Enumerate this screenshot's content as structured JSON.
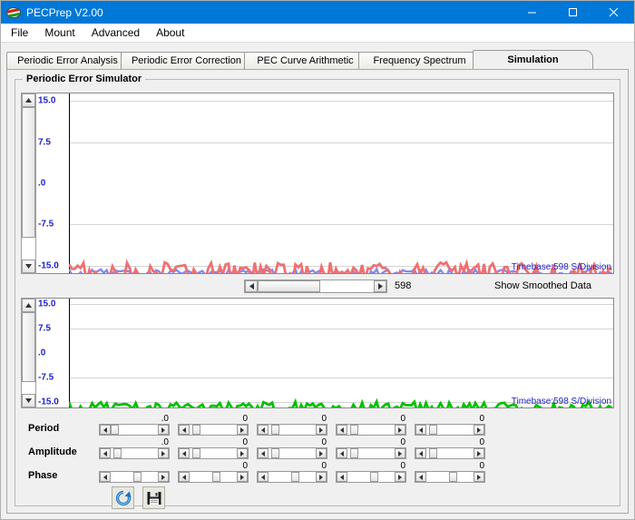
{
  "window": {
    "title": "PECPrep V2.00",
    "app_icon": "planet-icon",
    "controls": [
      {
        "name": "minimize-button",
        "glyph": "minimize-icon"
      },
      {
        "name": "maximize-button",
        "glyph": "maximize-icon"
      },
      {
        "name": "close-button",
        "glyph": "close-icon"
      }
    ]
  },
  "menubar": {
    "items": [
      {
        "label": "File"
      },
      {
        "label": "Mount"
      },
      {
        "label": "Advanced"
      },
      {
        "label": "About"
      }
    ]
  },
  "tabs": {
    "items": [
      {
        "label": "Periodic Error Analysis",
        "selected": false
      },
      {
        "label": "Periodic Error Correction",
        "selected": false
      },
      {
        "label": "PEC Curve Arithmetic",
        "selected": false
      },
      {
        "label": "Frequency Spectrum",
        "selected": false
      },
      {
        "label": "Simulation",
        "selected": true
      }
    ]
  },
  "groupbox": {
    "title": "Periodic Error Simulator"
  },
  "chart_data": [
    {
      "type": "line",
      "name": "raw-periodic-error-graph",
      "title": "",
      "xlabel": "",
      "ylabel": "",
      "ylim": [
        -15.0,
        15.0
      ],
      "yticks": [
        "15.0",
        "7.5",
        ".0",
        "-7.5",
        "-15.0"
      ],
      "ytick_values": [
        15.0,
        7.5,
        0.0,
        -7.5,
        -15.0
      ],
      "grid": true,
      "legend": "none",
      "annotation": "Timebase:598 S/Division",
      "series": [
        {
          "name": "smoothed",
          "color": "#8888ee",
          "amplitude": 0.35
        },
        {
          "name": "raw",
          "color": "#f07070",
          "amplitude": 0.9
        }
      ]
    },
    {
      "type": "line",
      "name": "simulated-periodic-error-graph",
      "title": "",
      "xlabel": "",
      "ylabel": "",
      "ylim": [
        -15.0,
        15.0
      ],
      "yticks": [
        "15.0",
        "7.5",
        ".0",
        "-7.5",
        "-15.0"
      ],
      "ytick_values": [
        15.0,
        7.5,
        0.0,
        -7.5,
        -15.0
      ],
      "grid": true,
      "legend": "none",
      "annotation": "Timebase:598 S/Division",
      "series": [
        {
          "name": "simulated",
          "color": "#00c000",
          "amplitude": 0.8
        }
      ]
    }
  ],
  "timebase_label": "Timebase:598 S/Division",
  "axis": {
    "ticks": [
      "15.0",
      "7.5",
      ".0",
      "-7.5",
      "-15.0"
    ]
  },
  "midrow": {
    "scroll_value": "598",
    "smoothed_label": "Show Smoothed Data",
    "smoothed_checked": true,
    "left_arrow": "left-arrow-icon",
    "right_arrow": "right-arrow-icon"
  },
  "parameters": {
    "rows": [
      {
        "label": "Period",
        "values": [
          ".0",
          "0",
          "0",
          "0",
          "0"
        ],
        "thumb_positions": [
          0,
          6,
          6,
          6,
          6
        ]
      },
      {
        "label": "Amplitude",
        "values": [
          ".0",
          "0",
          "0",
          "0",
          "0"
        ],
        "thumb_positions": [
          6,
          6,
          6,
          6,
          6
        ]
      },
      {
        "label": "Phase",
        "values": [
          "",
          "0",
          "0",
          "0",
          "0"
        ],
        "thumb_positions": [
          48,
          48,
          48,
          48,
          48
        ]
      }
    ]
  },
  "buttons": [
    {
      "name": "recalculate-button",
      "icon": "refresh-icon"
    },
    {
      "name": "save-button",
      "icon": "floppy-disk-icon"
    }
  ],
  "colors": {
    "accent": "#0078d7",
    "axis_text": "#2222cc",
    "trace_raw": "#f07070",
    "trace_smoothed": "#8888ee",
    "trace_simulated": "#00c000",
    "panel_bg": "#f0f0f0"
  }
}
